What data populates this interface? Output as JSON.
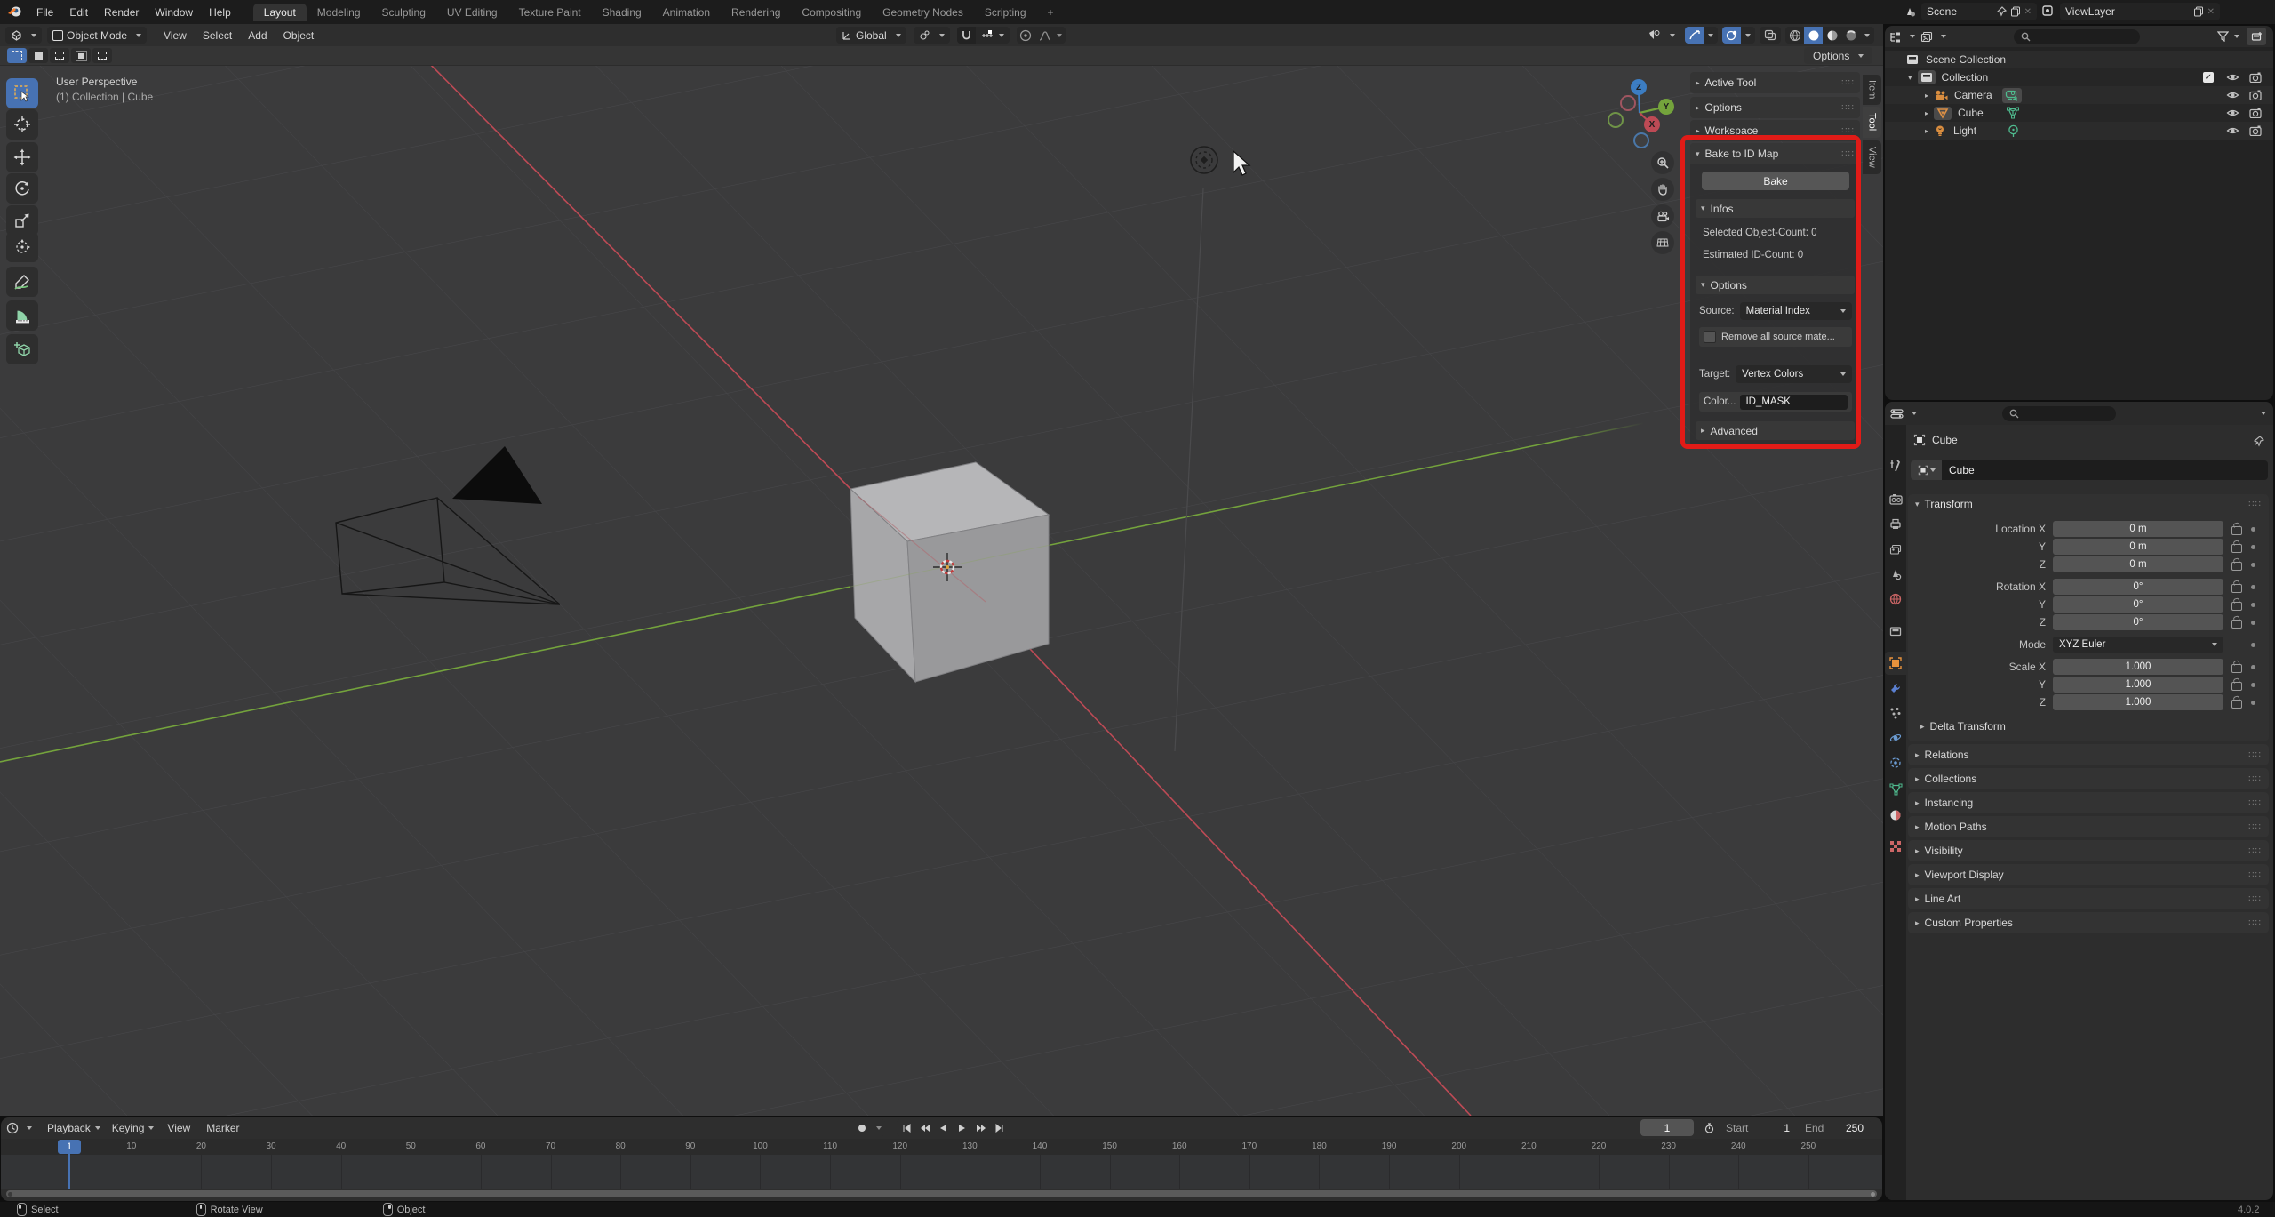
{
  "icons": {
    "chevron": "▾",
    "collapsed": "▸",
    "grip": "∷∷",
    "check": "✓",
    "plus": "+",
    "cross": "✕",
    "dot": "•",
    "search_hint": ""
  },
  "colors": {
    "accent": "#4772b3",
    "annotation_red": "#e11b17",
    "axis_x": "#bd4a55",
    "axis_y": "#74a33c",
    "axis_z": "#3c7dc2",
    "object_orange": "#dd9045",
    "data_green": "#4fba8e"
  },
  "topbar": {
    "menus": [
      "File",
      "Edit",
      "Render",
      "Window",
      "Help"
    ],
    "workspace_tabs": [
      "Layout",
      "Modeling",
      "Sculpting",
      "UV Editing",
      "Texture Paint",
      "Shading",
      "Animation",
      "Rendering",
      "Compositing",
      "Geometry Nodes",
      "Scripting"
    ],
    "add_tab": "+",
    "scene_label": "Scene",
    "view_layer_label": "ViewLayer"
  },
  "viewport": {
    "mode": "Object Mode",
    "menus": [
      "View",
      "Select",
      "Add",
      "Object"
    ],
    "orientation": "Global",
    "options_label": "Options",
    "overlay_view": "User Perspective",
    "overlay_context": "(1) Collection | Cube",
    "gizmo": {
      "x": "X",
      "y": "Y",
      "z": "Z"
    }
  },
  "sidebar": {
    "tabs": [
      "Item",
      "Tool",
      "View"
    ],
    "active_tab": "Tool",
    "collapsed_panels": [
      "Active Tool",
      "Options",
      "Workspace"
    ],
    "bake": {
      "title": "Bake to ID Map",
      "bake_button": "Bake",
      "infos_title": "Infos",
      "selected_count": "Selected Object-Count: 0",
      "estimated_count": "Estimated ID-Count: 0",
      "options_title": "Options",
      "source_label": "Source:",
      "source_value": "Material Index",
      "remove_checkbox_label": "Remove all source mate...",
      "target_label": "Target:",
      "target_value": "Vertex Colors",
      "color_label": "Color...",
      "color_value": "ID_MASK",
      "advanced_label": "Advanced"
    }
  },
  "outliner": {
    "scene_collection": "Scene Collection",
    "collection": "Collection",
    "objects": [
      "Camera",
      "Cube",
      "Light"
    ]
  },
  "properties": {
    "breadcrumb": "Cube",
    "name_field": "Cube",
    "transform": {
      "title": "Transform",
      "location_rows": [
        {
          "label": "Location X",
          "value": "0 m"
        },
        {
          "label": "Y",
          "value": "0 m"
        },
        {
          "label": "Z",
          "value": "0 m"
        }
      ],
      "rotation_rows": [
        {
          "label": "Rotation X",
          "value": "0°"
        },
        {
          "label": "Y",
          "value": "0°"
        },
        {
          "label": "Z",
          "value": "0°"
        }
      ],
      "mode_label": "Mode",
      "mode_value": "XYZ Euler",
      "scale_rows": [
        {
          "label": "Scale X",
          "value": "1.000"
        },
        {
          "label": "Y",
          "value": "1.000"
        },
        {
          "label": "Z",
          "value": "1.000"
        }
      ],
      "delta_label": "Delta Transform"
    },
    "collapsed_panels": [
      "Relations",
      "Collections",
      "Instancing",
      "Motion Paths",
      "Visibility",
      "Viewport Display",
      "Line Art",
      "Custom Properties"
    ]
  },
  "timeline": {
    "menus": [
      "Playback",
      "Keying",
      "View",
      "Marker"
    ],
    "ticks": [
      10,
      20,
      30,
      40,
      50,
      60,
      70,
      80,
      90,
      100,
      110,
      120,
      130,
      140,
      150,
      160,
      170,
      180,
      190,
      200,
      210,
      220,
      230,
      240,
      250
    ],
    "current_frame": "1",
    "frame_field": "1",
    "start_label": "Start",
    "start_value": "1",
    "end_label": "End",
    "end_value": "250"
  },
  "statusbar": {
    "hint_select": "Select",
    "hint_rotate": "Rotate View",
    "hint_object": "Object",
    "version": "4.0.2"
  }
}
